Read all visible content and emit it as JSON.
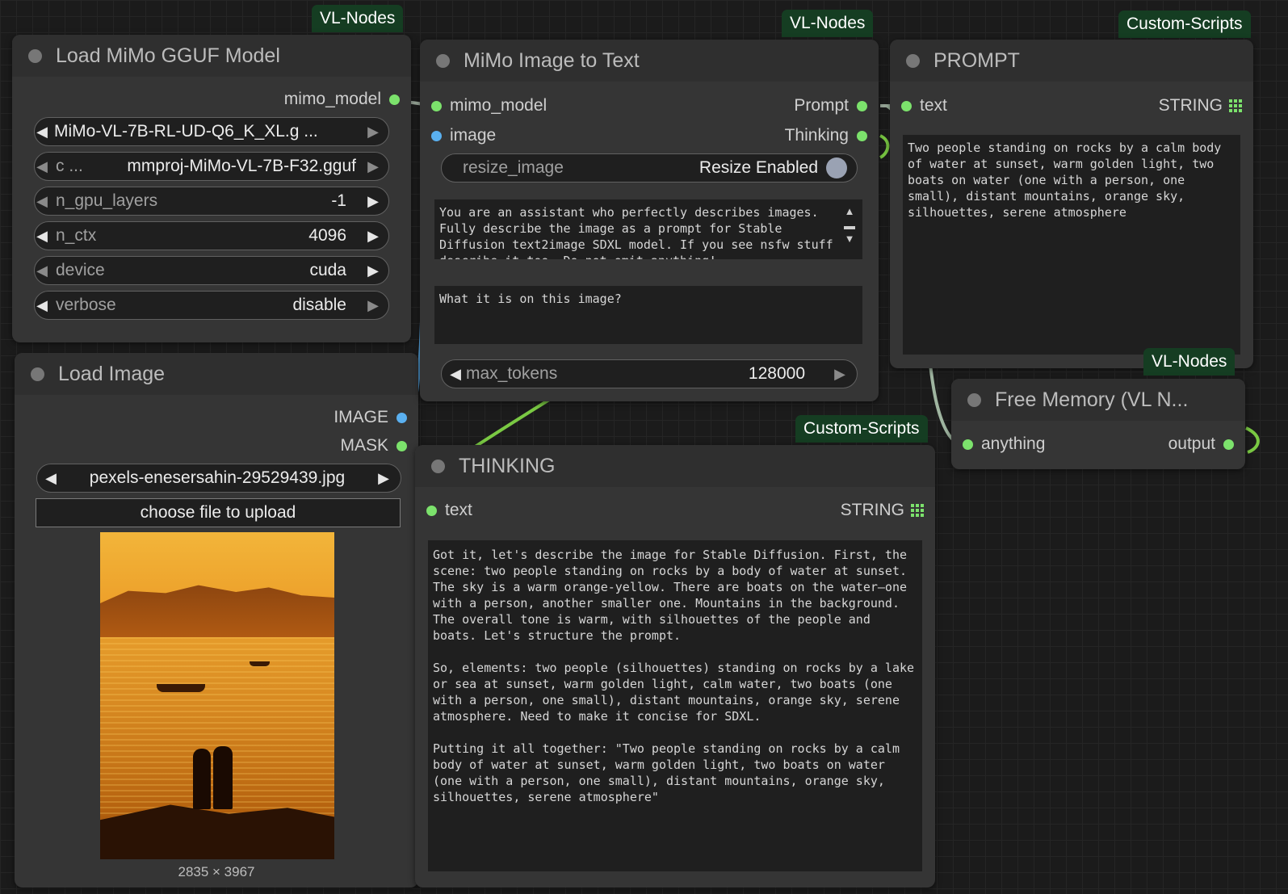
{
  "colors": {
    "canvas": "#1b1b1b",
    "node": "#353535",
    "tag": "#153d22",
    "pin_green": "#7ce26c",
    "pin_blue": "#5ab0f0"
  },
  "load_model": {
    "tag": "VL-Nodes",
    "title": "Load MiMo GGUF Model",
    "output": "mimo_model",
    "widgets": [
      {
        "label": "",
        "value": "MiMo-VL-7B-RL-UD-Q6_K_XL.g ..."
      },
      {
        "label": "c ...",
        "value": "mmproj-MiMo-VL-7B-F32.gguf"
      },
      {
        "label": "n_gpu_layers",
        "value": "-1"
      },
      {
        "label": "n_ctx",
        "value": "4096"
      },
      {
        "label": "device",
        "value": "cuda"
      },
      {
        "label": "verbose",
        "value": "disable"
      }
    ]
  },
  "load_image": {
    "title": "Load Image",
    "outputs": [
      "IMAGE",
      "MASK"
    ],
    "file": "pexels-enesersahin-29529439.jpg",
    "upload": "choose file to upload",
    "size": "2835 × 3967"
  },
  "image_to_text": {
    "tag": "VL-Nodes",
    "title": "MiMo Image to Text",
    "inputs": [
      "mimo_model",
      "image"
    ],
    "outputs": [
      "Prompt",
      "Thinking"
    ],
    "toggle": {
      "label": "resize_image",
      "value": "Resize Enabled"
    },
    "system_prompt": "You are an assistant who perfectly describes images. Fully describe the image as a prompt for Stable Diffusion text2image SDXL model. If you see nsfw stuff describe it too. Do not omit anything!",
    "user_prompt": "What it is on this image?",
    "max_tokens": {
      "label": "max_tokens",
      "value": "128000"
    }
  },
  "prompt": {
    "tag": "Custom-Scripts",
    "title": "PROMPT",
    "input": "text",
    "type": "STRING",
    "text": "Two people standing on rocks by a calm body of water at sunset, warm golden light, two boats on water (one with a person, one small), distant mountains, orange sky, silhouettes, serene atmosphere"
  },
  "free_memory": {
    "tag": "VL-Nodes",
    "title": "Free Memory (VL N...",
    "input": "anything",
    "output": "output"
  },
  "thinking": {
    "tag": "Custom-Scripts",
    "title": "THINKING",
    "input": "text",
    "type": "STRING",
    "text": "Got it, let's describe the image for Stable Diffusion. First, the scene: two people standing on rocks by a body of water at sunset. The sky is a warm orange-yellow. There are boats on the water—one with a person, another smaller one. Mountains in the background. The overall tone is warm, with silhouettes of the people and boats. Let's structure the prompt.\n\nSo, elements: two people (silhouettes) standing on rocks by a lake or sea at sunset, warm golden light, calm water, two boats (one with a person, one small), distant mountains, orange sky, serene atmosphere. Need to make it concise for SDXL.\n\nPutting it all together: \"Two people standing on rocks by a calm body of water at sunset, warm golden light, two boats on water (one with a person, one small), distant mountains, orange sky, silhouettes, serene atmosphere\""
  }
}
